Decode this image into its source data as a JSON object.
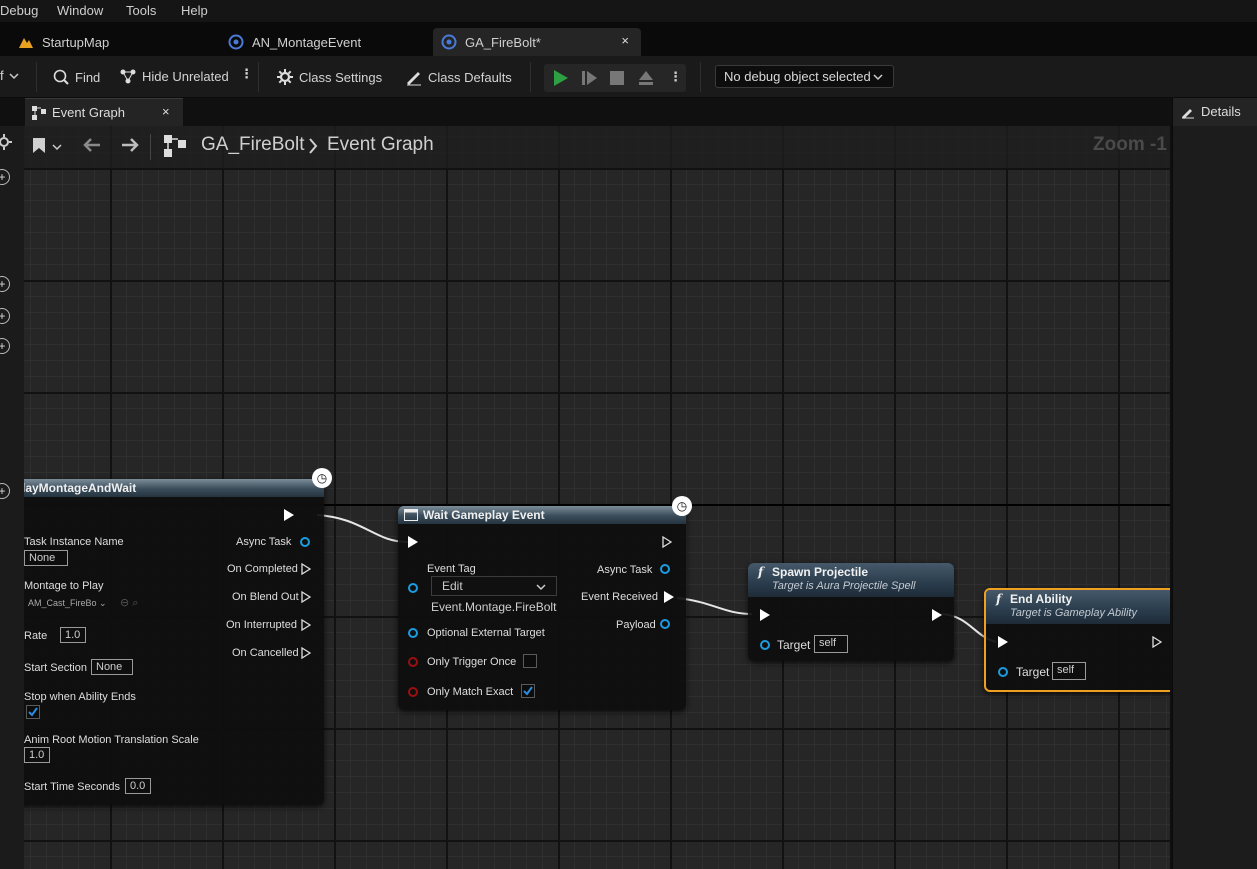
{
  "menu": [
    "Debug",
    "Window",
    "Tools",
    "Help"
  ],
  "tabs": [
    {
      "label": "StartupMap"
    },
    {
      "label": "AN_MontageEvent"
    },
    {
      "label": "GA_FireBolt*"
    }
  ],
  "toolbar": {
    "find": "Find",
    "hide_unrelated": "Hide Unrelated",
    "class_settings": "Class Settings",
    "class_defaults": "Class Defaults",
    "debug_object": "No debug object selected"
  },
  "graph_tab": "Event Graph",
  "details_tab": "Details",
  "breadcrumb": {
    "blueprint": "GA_FireBolt",
    "graph": "Event Graph",
    "zoom": "Zoom -1"
  },
  "nodes": {
    "play_montage": {
      "title": "layMontageAndWait",
      "task_instance_label": "Task Instance Name",
      "task_instance_value": "None",
      "montage_label": "Montage to Play",
      "montage_value": "AM_Cast_FireBo",
      "rate_label": "Rate",
      "rate_value": "1.0",
      "start_section_label": "Start Section",
      "start_section_value": "None",
      "stop_label": "Stop when Ability Ends",
      "root_motion_label": "Anim Root Motion Translation Scale",
      "root_motion_value": "1.0",
      "start_time_label": "Start Time Seconds",
      "start_time_value": "0.0",
      "outputs": [
        "Async Task",
        "On Completed",
        "On Blend Out",
        "On Interrupted",
        "On Cancelled"
      ]
    },
    "wait_event": {
      "title": "Wait Gameplay Event",
      "event_tag_label": "Event Tag",
      "edit_label": "Edit",
      "tag_value": "Event.Montage.FireBolt",
      "optional_target_label": "Optional External Target",
      "only_trigger_once_label": "Only Trigger Once",
      "only_match_exact_label": "Only Match Exact",
      "outputs": [
        "Async Task",
        "Event Received",
        "Payload"
      ]
    },
    "spawn_projectile": {
      "title": "Spawn Projectile",
      "subtitle": "Target is Aura Projectile Spell",
      "target_label": "Target",
      "target_value": "self"
    },
    "end_ability": {
      "title": "End Ability",
      "subtitle": "Target is Gameplay Ability",
      "target_label": "Target",
      "target_value": "self"
    }
  },
  "colors": {
    "accent_green": "#2ea043",
    "pin_blue": "#1c9ce0",
    "selection_orange": "#f0a020",
    "bool_red": "#9a1010"
  }
}
